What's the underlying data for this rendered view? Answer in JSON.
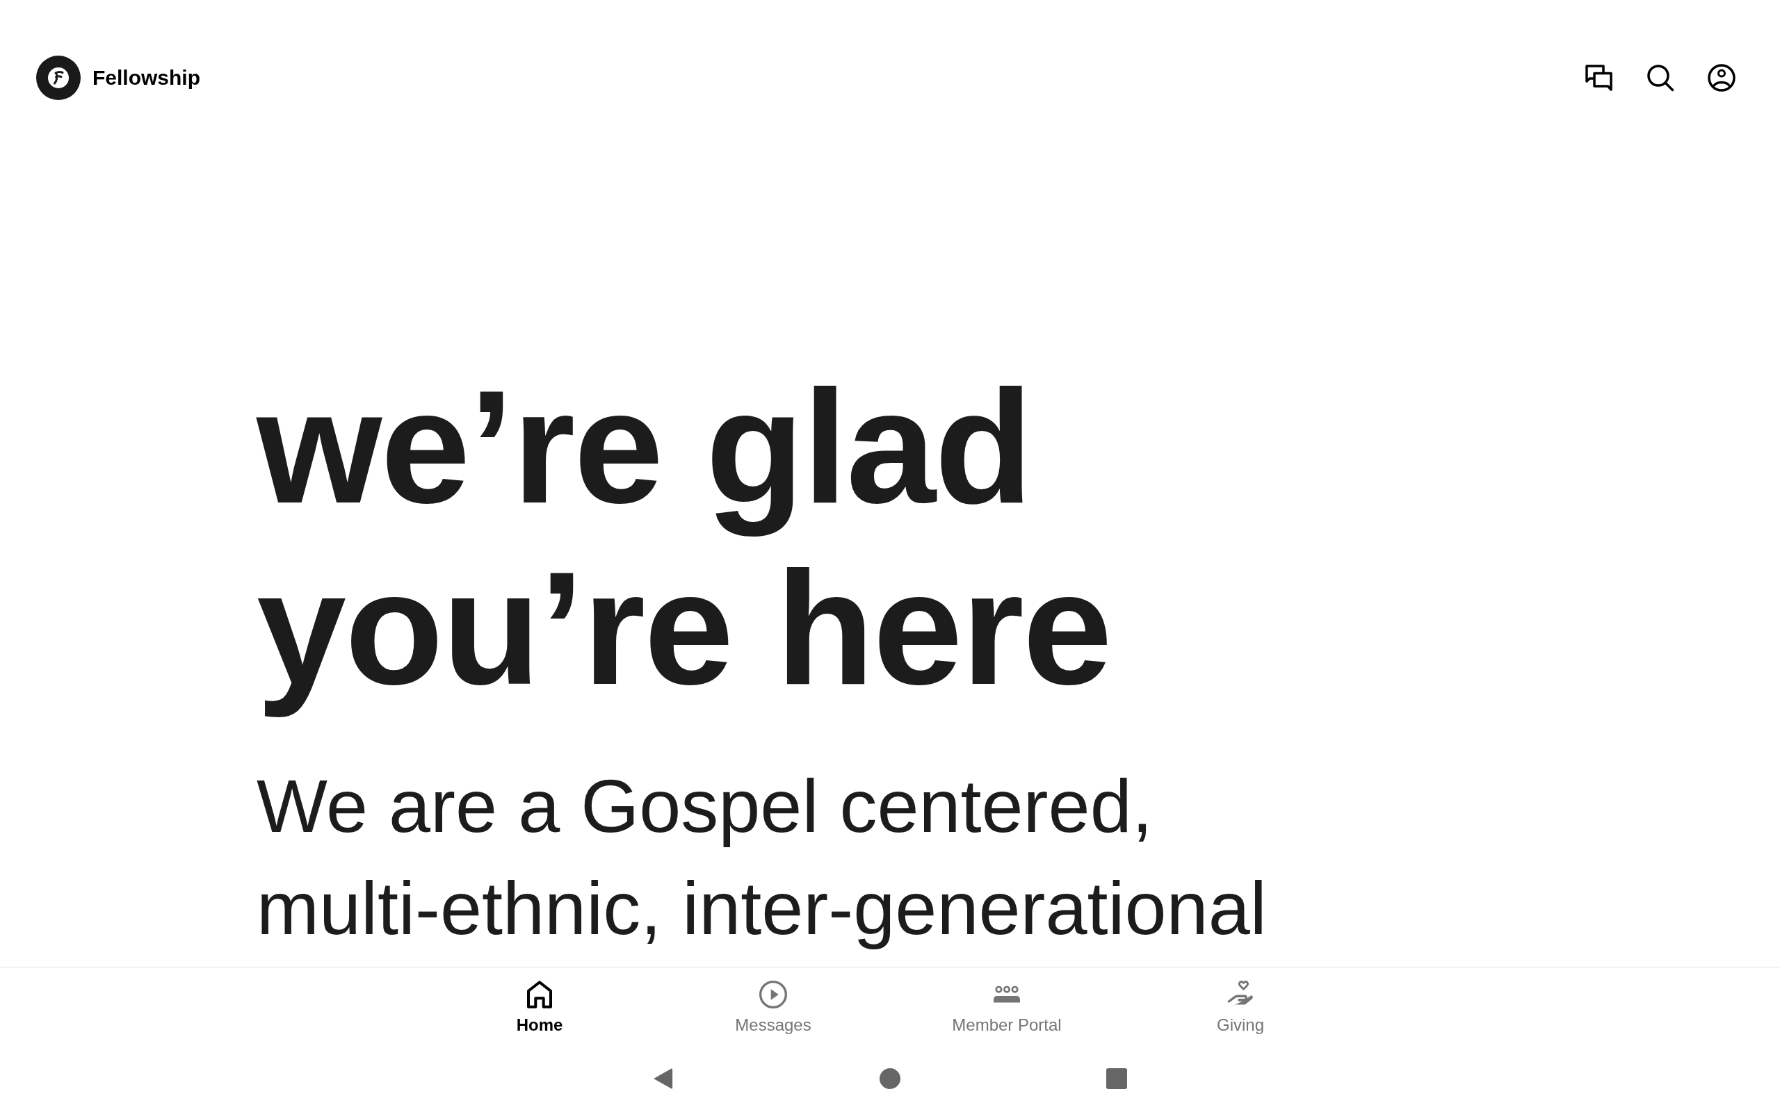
{
  "app_bar": {
    "title": "Fellowship"
  },
  "hero": {
    "headline": [
      "we’re glad",
      "you’re here"
    ],
    "body": [
      "We are a Gospel centered,",
      "multi-ethnic, inter-generational"
    ]
  },
  "tab_bar": {
    "tabs": [
      {
        "label": "Home",
        "kind": "home",
        "selected": true
      },
      {
        "label": "Messages",
        "kind": "play",
        "selected": false
      },
      {
        "label": "Member Portal",
        "kind": "group",
        "selected": false
      },
      {
        "label": "Giving",
        "kind": "giving",
        "selected": false
      }
    ]
  }
}
